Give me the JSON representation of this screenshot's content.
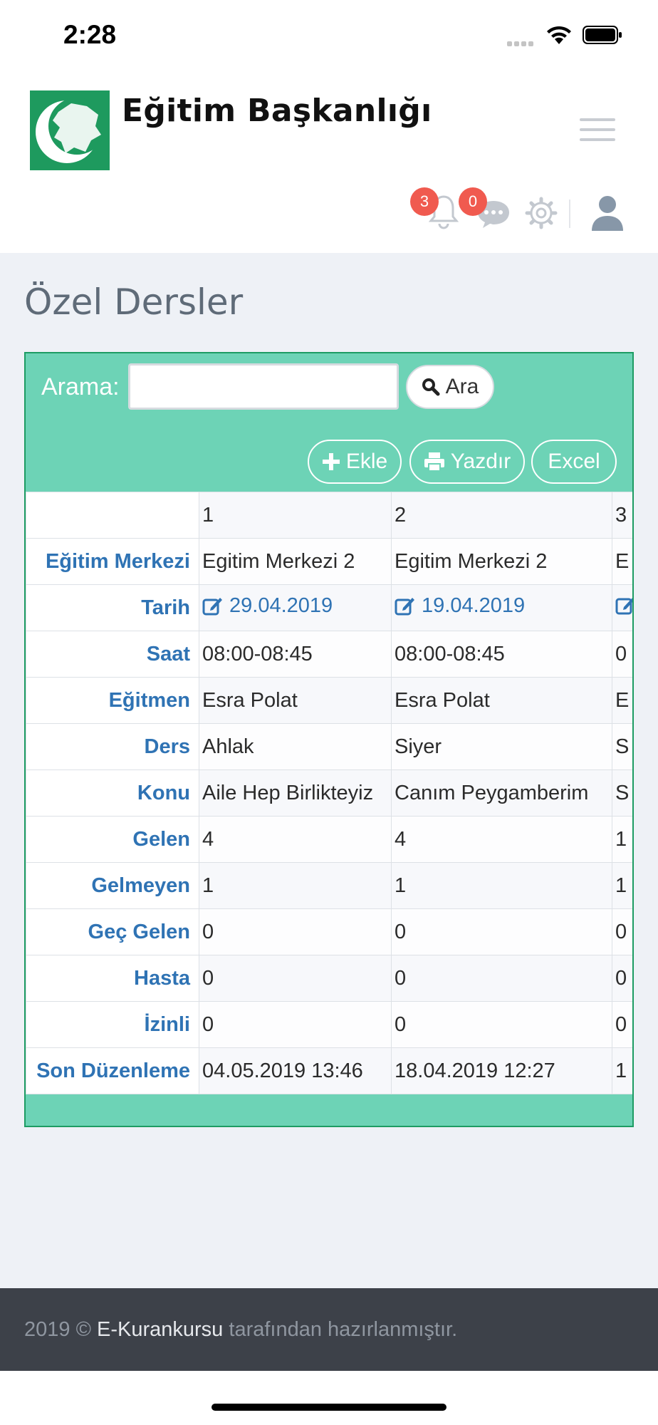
{
  "status_bar": {
    "time": "2:28"
  },
  "header": {
    "brand": "Eğitim Başkanlığı",
    "notifications_count": "3",
    "messages_count": "0",
    "icons": [
      "bell-icon",
      "chat-icon",
      "gear-icon",
      "user-icon",
      "menu-icon"
    ]
  },
  "page": {
    "title": "Özel Dersler"
  },
  "search": {
    "label": "Arama:",
    "value": "",
    "button_label": "Ara"
  },
  "actions": {
    "add_label": "Ekle",
    "print_label": "Yazdır",
    "excel_label": "Excel"
  },
  "table": {
    "columns": [
      "1",
      "2",
      "3"
    ],
    "rows": [
      {
        "label": "Eğitim Merkezi",
        "values": [
          "Egitim Merkezi 2",
          "Egitim Merkezi 2",
          "E"
        ]
      },
      {
        "label": "Tarih",
        "values": [
          "29.04.2019",
          "19.04.2019",
          ""
        ]
      },
      {
        "label": "Saat",
        "values": [
          "08:00-08:45",
          "08:00-08:45",
          "0"
        ]
      },
      {
        "label": "Eğitmen",
        "values": [
          "Esra Polat",
          "Esra Polat",
          "E"
        ]
      },
      {
        "label": "Ders",
        "values": [
          "Ahlak",
          "Siyer",
          "S"
        ]
      },
      {
        "label": "Konu",
        "values": [
          "Aile Hep Birlikteyiz",
          "Canım Peygamberim",
          "S"
        ]
      },
      {
        "label": "Gelen",
        "values": [
          "4",
          "4",
          "1"
        ]
      },
      {
        "label": "Gelmeyen",
        "values": [
          "1",
          "1",
          "1"
        ]
      },
      {
        "label": "Geç Gelen",
        "values": [
          "0",
          "0",
          "0"
        ]
      },
      {
        "label": "Hasta",
        "values": [
          "0",
          "0",
          "0"
        ]
      },
      {
        "label": "İzinli",
        "values": [
          "0",
          "0",
          "0"
        ]
      },
      {
        "label": "Son Düzenleme",
        "values": [
          "04.05.2019 13:46",
          "18.04.2019 12:27",
          "1"
        ]
      }
    ]
  },
  "footer": {
    "prefix": "2019 ©",
    "brand": "E-Kurankursu",
    "suffix": "tarafından hazırlanmıştır."
  },
  "colors": {
    "accent": "#6dd3b6",
    "link": "#2f73b4",
    "badge": "#f05a4f",
    "footer_bg": "#3d4149"
  }
}
